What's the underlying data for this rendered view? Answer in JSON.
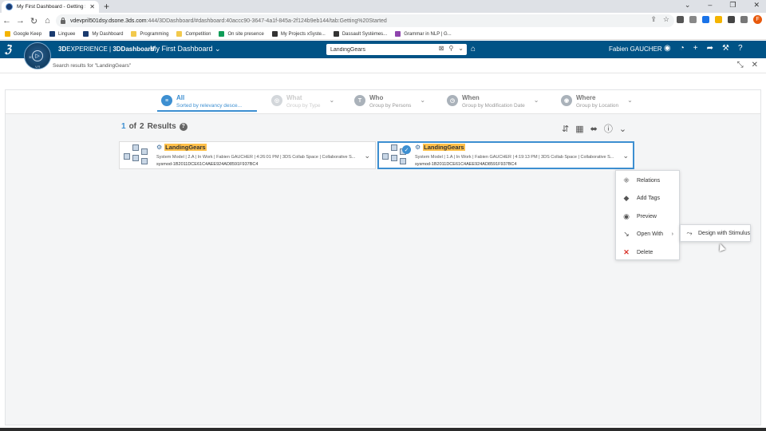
{
  "browser": {
    "tab_title": "My First Dashboard - Getting St...",
    "new_tab": "+",
    "url_host": "vdevpril501dsy.dsone.3ds.com",
    "url_path": ":444/3DDashboard/#dashboard:40accc90-3647-4a1f-845a-2f124b9eb144/tab:Getting%20Started",
    "profile_initial": "F"
  },
  "bookmarks": [
    {
      "label": "Google Keep",
      "color": "#f4b400"
    },
    {
      "label": "Linguee",
      "color": "#1a3a6e"
    },
    {
      "label": "My Dashboard",
      "color": "#1a3a6e"
    },
    {
      "label": "Programming",
      "color": "#f2c94c"
    },
    {
      "label": "Competition",
      "color": "#f2c94c"
    },
    {
      "label": "On site presence",
      "color": "#0f9d58"
    },
    {
      "label": "My Projects xSyste...",
      "color": "#333333"
    },
    {
      "label": "Dassault Systèmes...",
      "color": "#333333"
    },
    {
      "label": "Grammar in NLP | G...",
      "color": "#8e44ad"
    }
  ],
  "topbar": {
    "brand_bold": "3D",
    "brand_rest": "EXPERIENCE | ",
    "brand_app": "3DDashboard",
    "dashboard_name": "My First Dashboard",
    "search_value": "LandingGears",
    "user_name": "Fabien GAUCHER"
  },
  "compass": {
    "label_3d": "3D",
    "label_vr": "V,R"
  },
  "subbar": {
    "title": "Search results for \"LandingGears\""
  },
  "facets": [
    {
      "name": "All",
      "sub": "Sorted by relevancy desce...",
      "icon": "≡",
      "state": "active"
    },
    {
      "name": "What",
      "sub": "Group by Type",
      "icon": "◎",
      "state": "disabled"
    },
    {
      "name": "Who",
      "sub": "Group by Persons",
      "icon": "T",
      "state": "normal"
    },
    {
      "name": "When",
      "sub": "Group by Modification Date",
      "icon": "◷",
      "state": "normal"
    },
    {
      "name": "Where",
      "sub": "Group by Location",
      "icon": "◉",
      "state": "normal"
    }
  ],
  "results": {
    "current": "1",
    "of": "of",
    "total": "2",
    "label": "Results"
  },
  "tiles": [
    {
      "title": "LandingGears",
      "meta": "System Model | 2.A | In Work | Fabien GAUCHER | 4:26:01 PM | 3DS Collab Space | Collaborative S...",
      "id": "sysmod-1B2011DCE61C4AEE924AD8591F937BC4",
      "selected": false
    },
    {
      "title": "LandingGears",
      "meta": "System Model | 1.A | In Work | Fabien GAUCHER | 4:19:13 PM | 3DS Collab Space | Collaborative S...",
      "id": "sysmod-1B2011DCE61C4AEE924AD8591F937BC4",
      "selected": true
    }
  ],
  "context_menu": [
    {
      "label": "Relations",
      "icon": "⁜"
    },
    {
      "label": "Add Tags",
      "icon": "◆"
    },
    {
      "label": "Preview",
      "icon": "◉"
    },
    {
      "label": "Open With",
      "icon": "↘",
      "has_submenu": true
    },
    {
      "label": "Delete",
      "icon": "✕",
      "danger": true
    }
  ],
  "submenu": {
    "label": "Design with Stimulus",
    "icon": "⤳"
  }
}
